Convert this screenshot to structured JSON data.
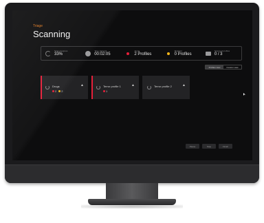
{
  "breadcrumb": "Triage",
  "page_title": "Scanning",
  "stats": [
    {
      "label": "Scan progress",
      "value": "33%",
      "icon": "progress-ring-icon"
    },
    {
      "label": "Time elapsed",
      "value": "00:02:05",
      "icon": "clock-icon"
    },
    {
      "label": "Alerts",
      "value": "2 Profiles",
      "icon": "red-dot-icon",
      "color": "#e6203a"
    },
    {
      "label": "Matches",
      "value": "0 Profiles",
      "icon": "yellow-dot-icon",
      "color": "#f5b61a"
    },
    {
      "label": "Scanned profiles",
      "value": "0 / 3",
      "icon": "box-icon"
    }
  ],
  "view_toggle": {
    "active": "Profiles view",
    "other": "Custom view"
  },
  "cards": [
    {
      "name": "Drugs",
      "alert": true,
      "red_count": "2",
      "yellow_count": "2"
    },
    {
      "name": "Terror profile 1",
      "alert": true,
      "red_count": "1"
    },
    {
      "name": "Terror profile 2",
      "alert": false
    }
  ],
  "footer_buttons": [
    "Pause",
    "Stop",
    "Finish"
  ],
  "colors": {
    "accent": "#e07a22",
    "alert": "#e6203a",
    "match": "#f5b61a"
  }
}
